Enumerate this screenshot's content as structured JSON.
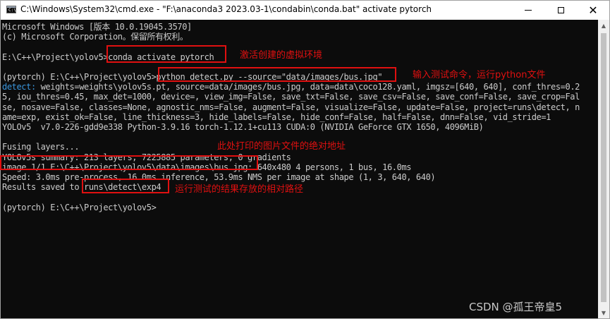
{
  "window": {
    "title": "C:\\Windows\\System32\\cmd.exe - \"F:\\anaconda3 2023.03-1\\condabin\\conda.bat\"  activate pytorch",
    "icon_label": "C:\\",
    "minimize_icon": "minimize-icon",
    "maximize_icon": "maximize-icon",
    "close_glyph": "✕"
  },
  "console": {
    "lines": [
      "Microsoft Windows [版本 10.0.19045.3570]",
      "(c) Microsoft Corporation。保留所有权利。",
      "",
      "E:\\C++\\Project\\yolov5>conda activate pytorch",
      "",
      "(pytorch) E:\\C++\\Project\\yolov5>python detect.py --source=\"data/images/bus.jpg\"",
      "detect: weights=weights\\yolov5s.pt, source=data/images/bus.jpg, data=data\\coco128.yaml, imgsz=[640, 640], conf_thres=0.2",
      "5, iou_thres=0.45, max_det=1000, device=, view_img=False, save_txt=False, save_csv=False, save_conf=False, save_crop=Fal",
      "se, nosave=False, classes=None, agnostic_nms=False, augment=False, visualize=False, update=False, project=runs\\detect, n",
      "ame=exp, exist_ok=False, line_thickness=3, hide_labels=False, hide_conf=False, half=False, dnn=False, vid_stride=1",
      "YOLOv5  v7.0-226-gdd9e338 Python-3.9.16 torch-1.12.1+cu113 CUDA:0 (NVIDIA GeForce GTX 1650, 4096MiB)",
      "",
      "Fusing layers...",
      "YOLOv5s summary: 213 layers, 7225885 parameters, 0 gradients",
      "image 1/1 E:\\C++\\Project\\yolov5\\data\\images\\bus.jpg: 640x480 4 persons, 1 bus, 16.0ms",
      "Speed: 3.0ms pre-process, 16.0ms inference, 53.9ms NMS per image at shape (1, 3, 640, 640)",
      "Results saved to runs\\detect\\exp4",
      "",
      "(pytorch) E:\\C++\\Project\\yolov5>"
    ],
    "detect_prefix": "detect:",
    "text_color": "#cccccc",
    "keyword_color": "#3a96dd"
  },
  "annotations": {
    "activate_env": "激活创建的虚拟环境",
    "run_command": "输入测试命令，运行python文件",
    "image_path": "此处打印的图片文件的绝对地址",
    "results_path": "运行测试的结果存放的相对路径",
    "color": "#e01010"
  },
  "watermark": "CSDN @孤王帝皇5"
}
